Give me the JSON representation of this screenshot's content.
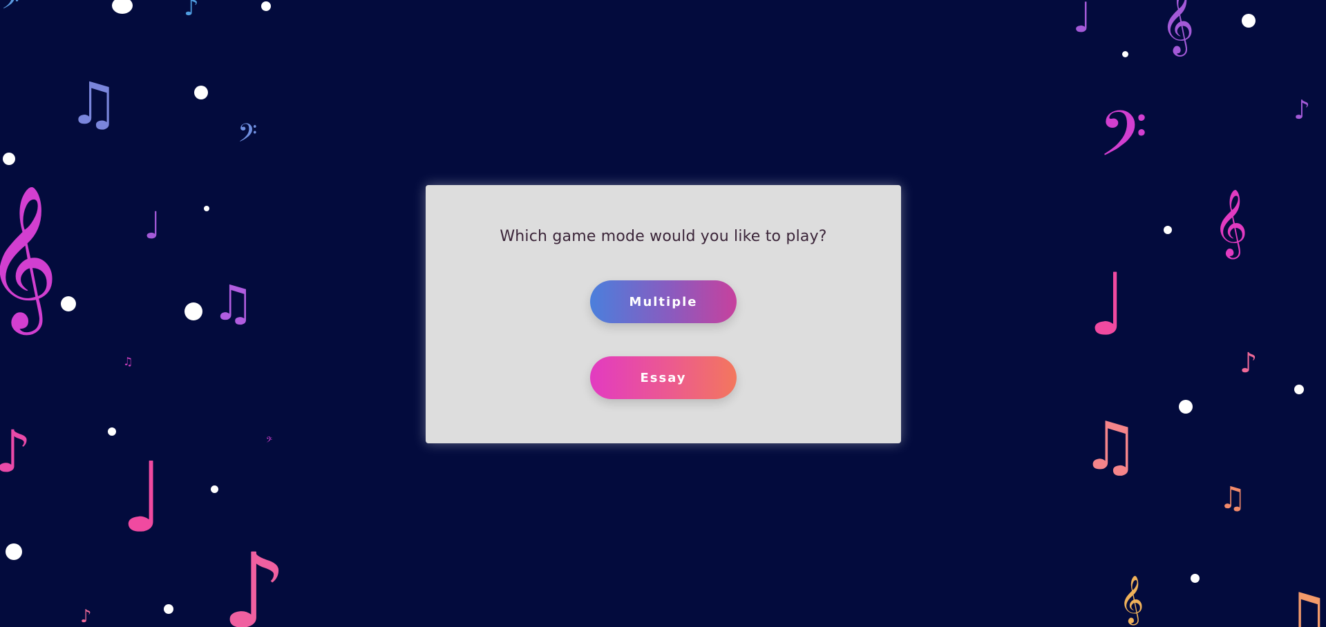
{
  "prompt": {
    "question": "Which game mode would you like to play?"
  },
  "modes": {
    "multiple_label": "Multiple",
    "essay_label": "Essay"
  },
  "background": {
    "color": "#030b3d",
    "note_colors": [
      "#6f8fe0",
      "#a45ad8",
      "#e23bc1",
      "#f06a98",
      "#f39a6a",
      "#f0b25a",
      "#5a9ae0"
    ],
    "decoration": [
      "music-note-icons",
      "white-dots"
    ]
  },
  "colors": {
    "card": "#dddddd",
    "question_text": "#3a2438",
    "multiple_gradient": [
      "#4b7fdc",
      "#c7419d"
    ],
    "essay_gradient": [
      "#e23bc1",
      "#f3775d"
    ]
  }
}
